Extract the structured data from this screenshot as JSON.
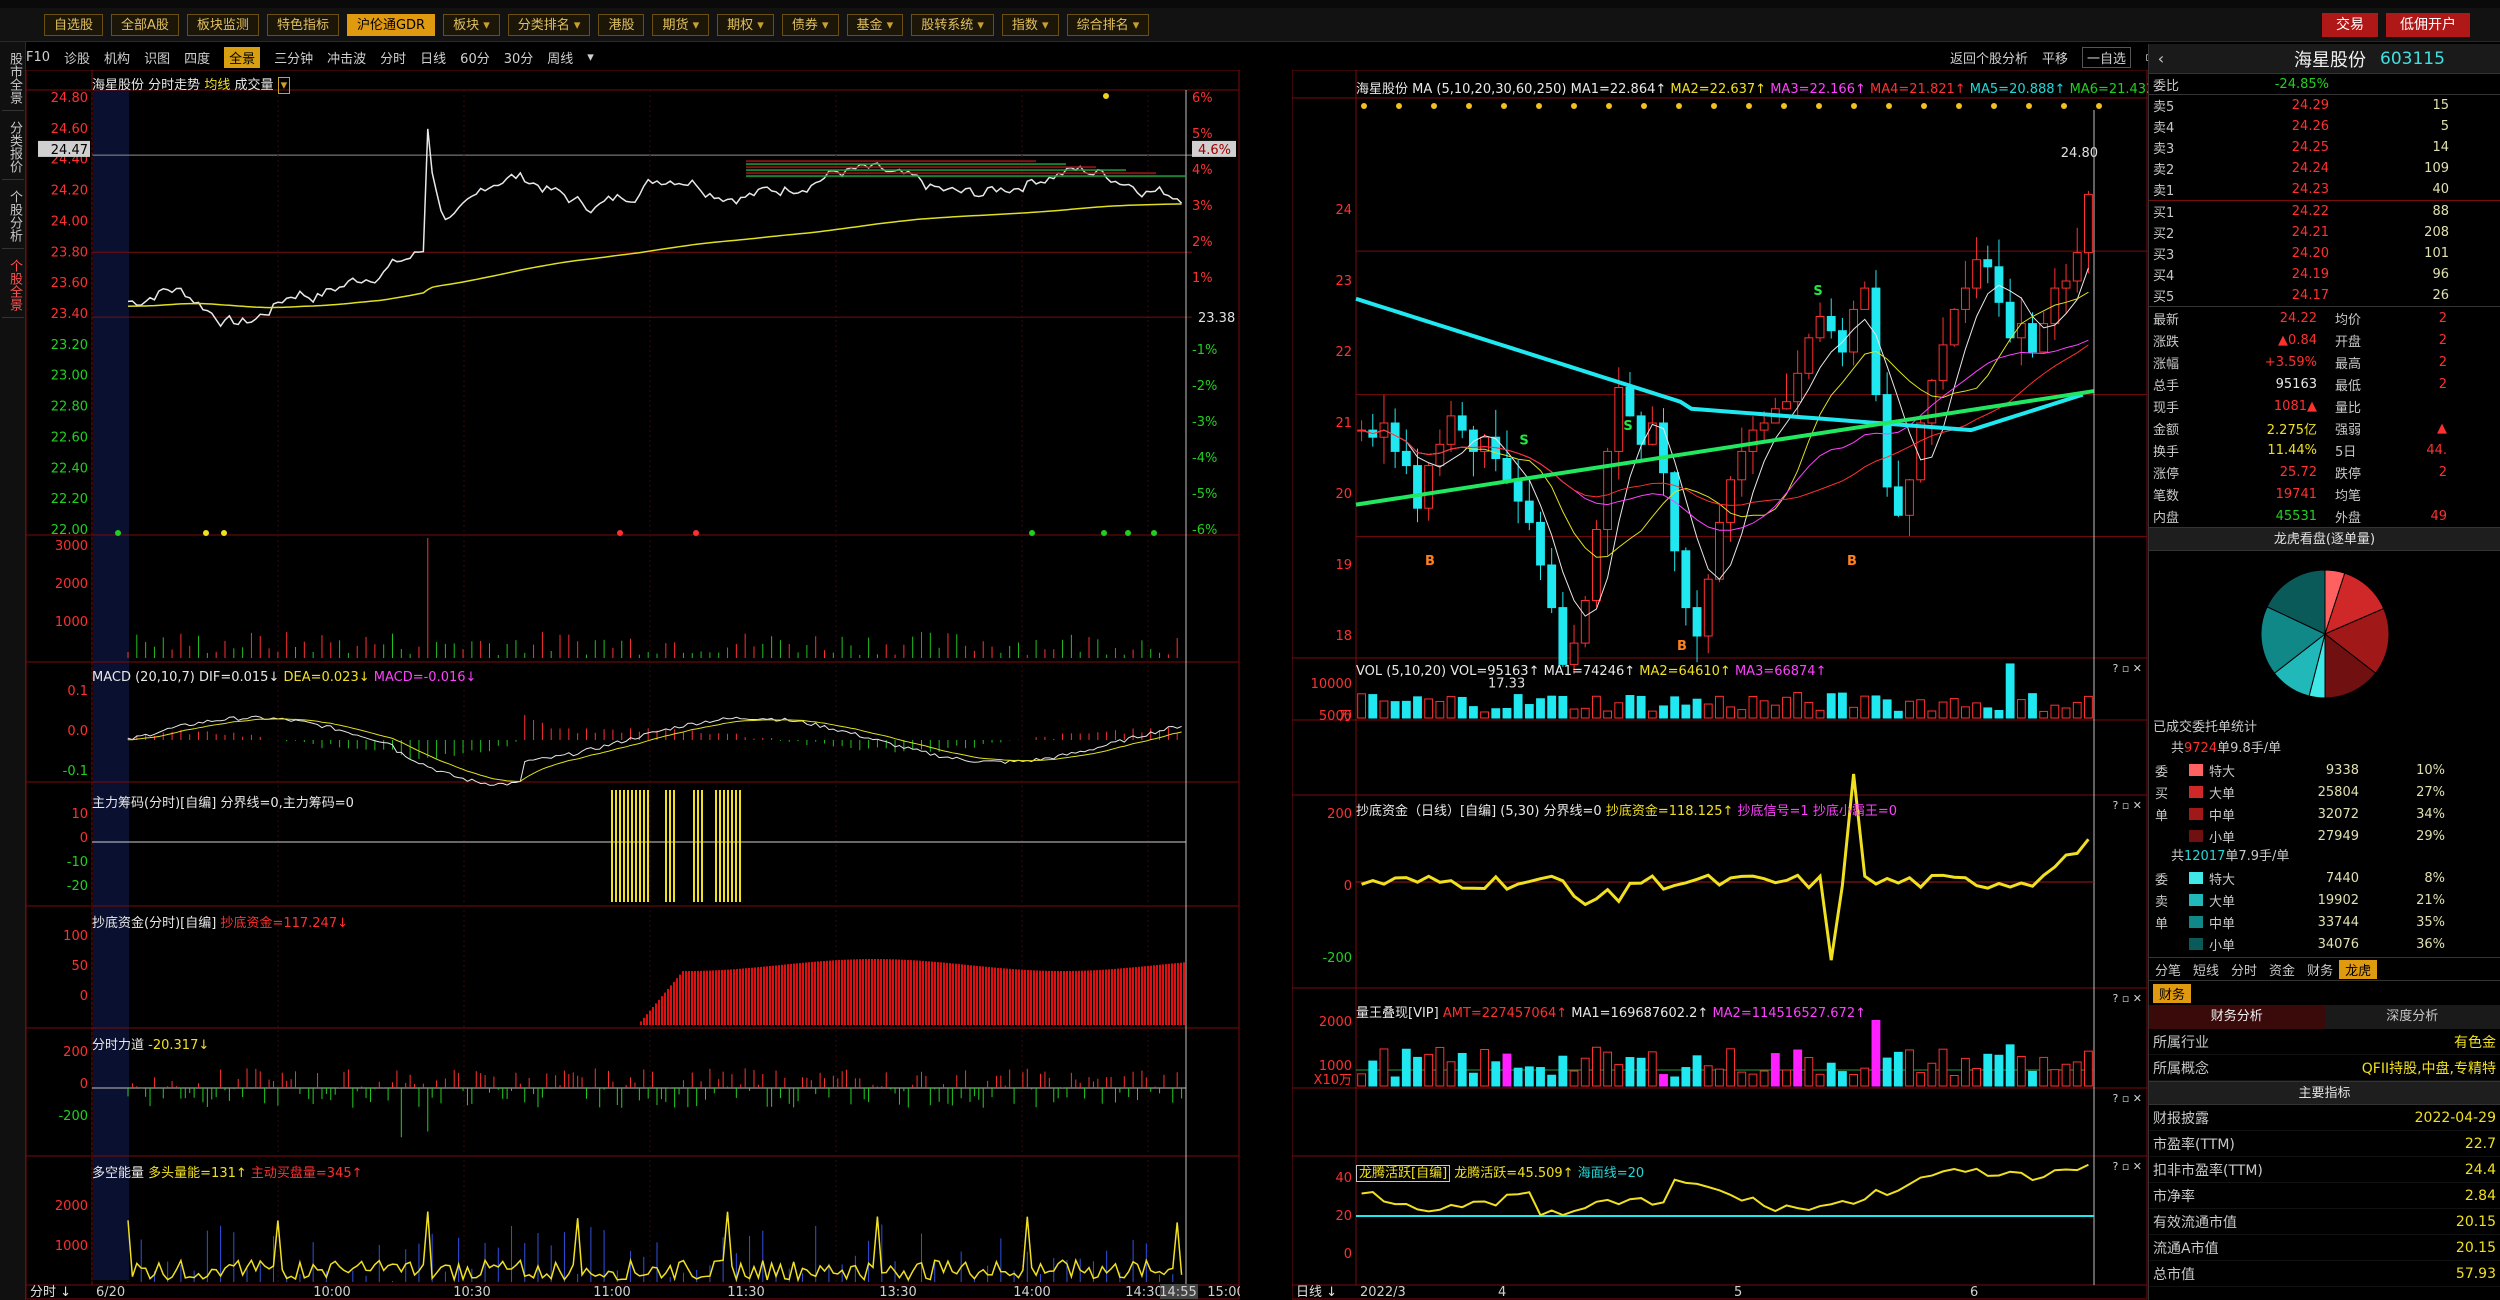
{
  "toolbar": {
    "items": [
      "自选股",
      "全部A股",
      "板块监测",
      "特色指标",
      "沪伦通GDR",
      "板块",
      "分类排名",
      "港股",
      "期货",
      "期权",
      "债券",
      "基金",
      "股转系统",
      "指数",
      "综合排名"
    ],
    "active_index": 4,
    "trade_label": "交易",
    "open_account_label": "低佣开户"
  },
  "left_rail": {
    "tabs": [
      "股市全景",
      "分类报价",
      "个股分析",
      "个股全景"
    ],
    "active_index": 3
  },
  "sub_bar": {
    "items": [
      "F10",
      "诊股",
      "机构",
      "识图",
      "四度",
      "全景",
      "三分钟",
      "冲击波",
      "分时",
      "日线",
      "60分",
      "30分",
      "周线"
    ],
    "active_index": 5
  },
  "right_top": {
    "back_label": "返回个股分析",
    "mode_label": "平移",
    "watch_label": "一自选"
  },
  "intraday": {
    "title_stock": "海星股份",
    "title_parts": [
      "分时走势",
      "均线",
      "成交量"
    ],
    "price_ticks": [
      "24.80",
      "24.60",
      "24.40",
      "24.20",
      "24.00",
      "23.80",
      "23.60",
      "23.40",
      "23.20",
      "23.00",
      "22.80",
      "22.60",
      "22.40",
      "22.20",
      "22.00"
    ],
    "pct_ticks": [
      "6%",
      "5%",
      "4%",
      "3%",
      "2%",
      "1%",
      "",
      "-1%",
      "-2%",
      "-3%",
      "-4%",
      "-5%",
      "-6%"
    ],
    "last_price_tag": "24.47",
    "last_pct_tag": "4.6%",
    "preclose_label": "23.38",
    "volume_ticks": [
      "3000",
      "2000",
      "1000"
    ],
    "x_labels": [
      "6/20",
      "10:00",
      "10:30",
      "11:00",
      "11:30",
      "13:30",
      "14:00",
      "14:30",
      "14:55",
      "15:00"
    ],
    "x_start_label": "分时",
    "macd_title": "MACD",
    "macd_params": "(20,10,7)",
    "macd_values": [
      "DIF=0.015↓",
      "DEA=0.023↓",
      "MACD=-0.016↓"
    ],
    "macd_ticks": [
      "0.1",
      "0.0",
      "-0.1"
    ],
    "zl_title": "主力筹码(分时)[自编]",
    "zl_values": "分界线=0,主力筹码=0",
    "zl_ticks": [
      "10",
      "0",
      "-10",
      "-20"
    ],
    "cd_title": "抄底资金(分时)[自编]",
    "cd_values": "抄底资金=117.247↓",
    "cd_ticks": [
      "100",
      "50",
      "0"
    ],
    "fl_title": "分时力道",
    "fl_values": "-20.317↓",
    "fl_ticks": [
      "200",
      "0",
      "-200"
    ],
    "dk_title": "多空能量",
    "dk_values": [
      "多头量能=131↑",
      "主动买盘量=345↑"
    ],
    "dk_ticks": [
      "2000",
      "1000"
    ]
  },
  "daily": {
    "title_stock": "海星股份",
    "ma_label": "MA",
    "ma_params": "(5,10,20,30,60,250)",
    "ma_values": [
      "MA1=22.864↑",
      "MA2=22.637↑",
      "MA3=22.166↑",
      "MA4=21.821↑",
      "MA5=20.888↑",
      "MA6=21.432↑"
    ],
    "price_ticks": [
      "24",
      "23",
      "22",
      "21",
      "20",
      "19",
      "18"
    ],
    "high_label": "24.80",
    "low_label": "17.33",
    "vol_title": "VOL",
    "vol_params": "(5,10,20)",
    "vol_values": [
      "VOL=95163↑",
      "MA1=74246↑",
      "MA2=64610↑",
      "MA3=66874↑"
    ],
    "vol_ticks": [
      "10000",
      "5000"
    ],
    "vol_unit": "万",
    "cd_title": "抄底资金（日线）[自编]",
    "cd_params": "(5,30)",
    "cd_values": [
      "分界线=0",
      "抄底资金=118.125↑",
      "抄底信号=1",
      "抄底小霸王=0"
    ],
    "cd_ticks": [
      "200",
      "0",
      "-200"
    ],
    "lw_title": "量王叠现[VIP]",
    "lw_values": [
      "AMT=227457064↑",
      "MA1=169687602.2↑",
      "MA2=114516527.672↑"
    ],
    "lw_ticks": [
      "2000",
      "1000"
    ],
    "lw_unit": "X10万",
    "lt_title": "龙腾活跃[自编]",
    "lt_values": [
      "龙腾活跃=45.509↑",
      "海面线=20"
    ],
    "lt_ticks": [
      "40",
      "20",
      "0"
    ],
    "x_labels": [
      "2022/3",
      "4",
      "5",
      "6"
    ],
    "x_start_label": "日线"
  },
  "quote": {
    "name": "海星股份",
    "code": "603115",
    "webi_label": "委比",
    "webi_value": "-24.85%",
    "webi_right": "",
    "asks": [
      {
        "label": "卖5",
        "price": "24.29",
        "vol": "15"
      },
      {
        "label": "卖4",
        "price": "24.26",
        "vol": "5"
      },
      {
        "label": "卖3",
        "price": "24.25",
        "vol": "14"
      },
      {
        "label": "卖2",
        "price": "24.24",
        "vol": "109"
      },
      {
        "label": "卖1",
        "price": "24.23",
        "vol": "40"
      }
    ],
    "bids": [
      {
        "label": "买1",
        "price": "24.22",
        "vol": "88"
      },
      {
        "label": "买2",
        "price": "24.21",
        "vol": "208"
      },
      {
        "label": "买3",
        "price": "24.20",
        "vol": "101"
      },
      {
        "label": "买4",
        "price": "24.19",
        "vol": "96"
      },
      {
        "label": "买5",
        "price": "24.17",
        "vol": "26"
      }
    ],
    "stats": [
      {
        "k": "最新",
        "a": "24.22",
        "k2": "均价",
        "b": "2"
      },
      {
        "k": "涨跌",
        "a": "▲0.84",
        "k2": "开盘",
        "b": "2"
      },
      {
        "k": "涨幅",
        "a": "+3.59%",
        "k2": "最高",
        "b": "2"
      },
      {
        "k": "总手",
        "a": "95163",
        "k2": "最低",
        "b": "2"
      },
      {
        "k": "现手",
        "a": "1081▲",
        "k2": "量比",
        "b": ""
      },
      {
        "k": "金额",
        "a": "2.275亿",
        "k2": "强弱",
        "b": "▲"
      },
      {
        "k": "换手",
        "a": "11.44%",
        "k2": "5日",
        "b": "44."
      },
      {
        "k": "涨停",
        "a": "25.72",
        "k2": "跌停",
        "b": "2"
      },
      {
        "k": "笔数",
        "a": "19741",
        "k2": "均笔",
        "b": ""
      },
      {
        "k": "内盘",
        "a": "45531",
        "k2": "外盘",
        "b": "49"
      }
    ],
    "pie_title": "龙虎看盘(逐单量)",
    "order_title": "已成交委托单统计",
    "buy_summary": {
      "pre": "共",
      "count": "9724",
      "post": "单9.8手/单"
    },
    "buy_rows": [
      {
        "t": "委",
        "name": "特大",
        "c": "9338",
        "pc": "10%"
      },
      {
        "t": "买",
        "name": "大单",
        "c": "25804",
        "pc": "27%"
      },
      {
        "t": "单",
        "name": "中单",
        "c": "32072",
        "pc": "34%"
      },
      {
        "t": "",
        "name": "小单",
        "c": "27949",
        "pc": "29%"
      }
    ],
    "sell_summary": {
      "pre": "共",
      "count": "12017",
      "post": "单7.9手/单"
    },
    "sell_rows": [
      {
        "t": "委",
        "name": "特大",
        "c": "7440",
        "pc": "8%"
      },
      {
        "t": "卖",
        "name": "大单",
        "c": "19902",
        "pc": "21%"
      },
      {
        "t": "单",
        "name": "中单",
        "c": "33744",
        "pc": "35%"
      },
      {
        "t": "",
        "name": "小单",
        "c": "34076",
        "pc": "36%"
      }
    ],
    "tabs": [
      "分笔",
      "短线",
      "分时",
      "资金",
      "财务",
      "龙虎"
    ],
    "active_tab": 5,
    "fin_tab": "财务",
    "fin_sub": [
      "财务分析",
      "深度分析"
    ],
    "fin_rows": [
      {
        "k": "所属行业",
        "v": "有色金"
      },
      {
        "k": "所属概念",
        "v": "QFII持股,中盘,专精特"
      }
    ],
    "main_title": "主要指标",
    "main_rows": [
      {
        "k": "财报披露",
        "v": "2022-04-29"
      },
      {
        "k": "市盈率(TTM)",
        "v": "22.7"
      },
      {
        "k": "扣非市盈率(TTM)",
        "v": "24.4"
      },
      {
        "k": "市净率",
        "v": "2.84"
      },
      {
        "k": "有效流通市值",
        "v": "20.15"
      },
      {
        "k": "流通A市值",
        "v": "20.15"
      },
      {
        "k": "总市值",
        "v": "57.93"
      }
    ]
  },
  "colors": {
    "up": "#ff3030",
    "down": "#20d020",
    "cyan": "#20e8f0",
    "yellow": "#f0e020",
    "border": "#7a0c0c"
  }
}
